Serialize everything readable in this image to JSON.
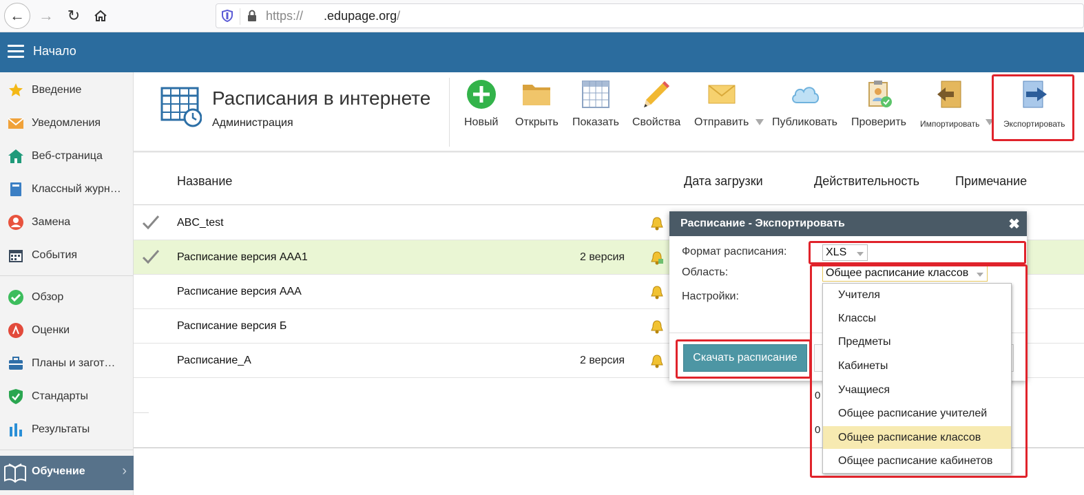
{
  "browser": {
    "url_prefix": "https://",
    "url_domain": ".edupage.org",
    "url_suffix": "/"
  },
  "header": {
    "title": "Начало"
  },
  "sidebar": {
    "items": [
      {
        "label": "Введение",
        "icon": "star-icon"
      },
      {
        "label": "Уведомления",
        "icon": "envelope-icon"
      },
      {
        "label": "Веб-страница",
        "icon": "house-icon"
      },
      {
        "label": "Классный журнал",
        "icon": "book-icon"
      },
      {
        "label": "Замена",
        "icon": "person-icon"
      },
      {
        "label": "События",
        "icon": "calendar-icon"
      },
      {
        "label": "Обзор",
        "icon": "check-circle-icon"
      },
      {
        "label": "Оценки",
        "icon": "grade-icon"
      },
      {
        "label": "Планы и заготовки",
        "icon": "briefcase-icon"
      },
      {
        "label": "Стандарты",
        "icon": "shield-icon"
      },
      {
        "label": "Результаты",
        "icon": "bar-chart-icon"
      }
    ],
    "active": {
      "label": "Обучение",
      "icon": "open-book-icon"
    }
  },
  "titleblock": {
    "title": "Расписания в интернете",
    "subtitle": "Администрация"
  },
  "toolbar": {
    "new": "Новый",
    "open": "Открыть",
    "show": "Показать",
    "properties": "Свойства",
    "send": "Отправить",
    "publish": "Публиковать",
    "check": "Проверить",
    "import": "Импортировать",
    "export": "Экспортировать"
  },
  "table": {
    "headers": {
      "name": "Название",
      "upload_date": "Дата загрузки",
      "validity": "Действительность",
      "note": "Примечание"
    },
    "rows": [
      {
        "name": "ABC_test",
        "version": "",
        "checked": true,
        "selected": false
      },
      {
        "name": "Расписание версия AAA1",
        "version": "2 версия",
        "checked": true,
        "selected": true
      },
      {
        "name": "Расписание версия AAA",
        "version": "",
        "checked": false,
        "selected": false
      },
      {
        "name": "Расписание версия Б",
        "version": "",
        "checked": false,
        "selected": false
      },
      {
        "name": "Расписание_А",
        "version": "2 версия",
        "checked": false,
        "selected": false
      }
    ],
    "partial_values": [
      "0",
      "0"
    ]
  },
  "dialog": {
    "title": "Расписание - Экспортировать",
    "format_label": "Формат расписания:",
    "format_value": "XLS",
    "area_label": "Область:",
    "area_value": "Общее расписание классов",
    "settings_label": "Настройки:",
    "download_button": "Скачать расписание",
    "area_options": [
      "Учителя",
      "Классы",
      "Предметы",
      "Кабинеты",
      "Учащиеся",
      "Общее расписание учителей",
      "Общее расписание классов",
      "Общее расписание кабинетов"
    ],
    "highlighted_option": "Общее расписание классов"
  },
  "colors": {
    "header_blue": "#2b6c9e",
    "annotation_red": "#e0232b",
    "download_button": "#4d96a4",
    "selected_row": "#eaf6d4"
  }
}
